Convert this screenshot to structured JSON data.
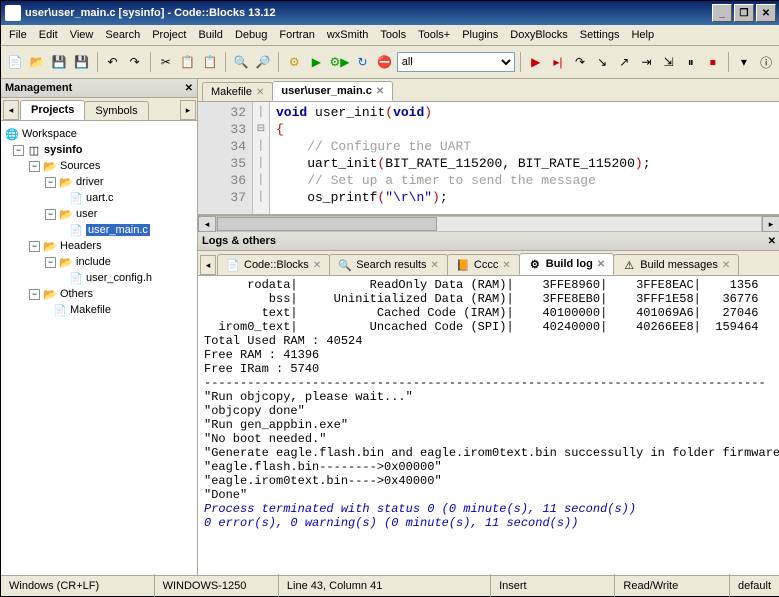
{
  "title": "user\\user_main.c [sysinfo] - Code::Blocks 13.12",
  "menus": [
    "File",
    "Edit",
    "View",
    "Search",
    "Project",
    "Build",
    "Debug",
    "Fortran",
    "wxSmith",
    "Tools",
    "Tools+",
    "Plugins",
    "DoxyBlocks",
    "Settings",
    "Help"
  ],
  "target_selector": "all",
  "mgmt": {
    "title": "Management",
    "tabs": [
      "Projects",
      "Symbols"
    ],
    "active_tab": 0,
    "tree": {
      "workspace": "Workspace",
      "project": "sysinfo",
      "folders": [
        {
          "name": "Sources",
          "children": [
            {
              "name": "driver",
              "children": [
                {
                  "name": "uart.c"
                }
              ]
            },
            {
              "name": "user",
              "children": [
                {
                  "name": "user_main.c",
                  "selected": true
                }
              ]
            }
          ]
        },
        {
          "name": "Headers",
          "children": [
            {
              "name": "include",
              "children": [
                {
                  "name": "user_config.h"
                }
              ]
            }
          ]
        },
        {
          "name": "Others",
          "children": [
            {
              "name": "Makefile"
            }
          ]
        }
      ]
    }
  },
  "editor": {
    "tabs": [
      {
        "label": "Makefile",
        "active": false
      },
      {
        "label": "user\\user_main.c",
        "active": true
      }
    ],
    "first_line": 32,
    "lines": [
      {
        "n": 32,
        "html": "<span class='kw'>void</span> <span class='fn'>user_init</span><span class='br'>(</span><span class='kw'>void</span><span class='br'>)</span>"
      },
      {
        "n": 33,
        "html": "<span class='br'>{</span>",
        "fold": "⊟"
      },
      {
        "n": 34,
        "html": "    <span class='cm'>// Configure the UART</span>"
      },
      {
        "n": 35,
        "html": "    uart_init<span class='br'>(</span>BIT_RATE_115200, BIT_RATE_115200<span class='br'>)</span>;"
      },
      {
        "n": 36,
        "html": "    <span class='cm'>// Set up a timer to send the message</span>"
      },
      {
        "n": 37,
        "html": "    os_printf<span class='br'>(</span><span class='str'>\"\\r\\n\"</span><span class='br'>)</span>;"
      }
    ]
  },
  "logs": {
    "title": "Logs & others",
    "tabs": [
      {
        "label": "Code::Blocks",
        "icon": "📄"
      },
      {
        "label": "Search results",
        "icon": "🔍"
      },
      {
        "label": "Cccc",
        "icon": "📙"
      },
      {
        "label": "Build log",
        "icon": "⚙",
        "active": true
      },
      {
        "label": "Build messages",
        "icon": "⚠"
      }
    ],
    "text": "      rodata|          ReadOnly Data (RAM)|    3FFE8960|    3FFE8EAC|    1356\n         bss|     Uninitialized Data (RAM)|    3FFE8EB0|    3FFF1E58|   36776\n        text|           Cached Code (IRAM)|    40100000|    401069A6|   27046\n  irom0_text|          Uncached Code (SPI)|    40240000|    40266EE8|  159464\nTotal Used RAM : 40524\nFree RAM : 41396\nFree IRam : 5740\n------------------------------------------------------------------------------\n\"Run objcopy, please wait...\"\n\"objcopy done\"\n\"Run gen_appbin.exe\"\n\"No boot needed.\"\n\"Generate eagle.flash.bin and eagle.irom0text.bin successully in folder firmware.\"\n\"eagle.flash.bin-------->0x00000\"\n\"eagle.irom0text.bin---->0x40000\"\n\"Done\"",
    "proc1": "Process terminated with status 0 (0 minute(s), 11 second(s))",
    "proc2": "0 error(s), 0 warning(s) (0 minute(s), 11 second(s))"
  },
  "status": {
    "eol": "Windows (CR+LF)",
    "enc": "WINDOWS-1250",
    "pos": "Line 43, Column 41",
    "ins": "Insert",
    "rw": "Read/Write",
    "prof": "default"
  }
}
